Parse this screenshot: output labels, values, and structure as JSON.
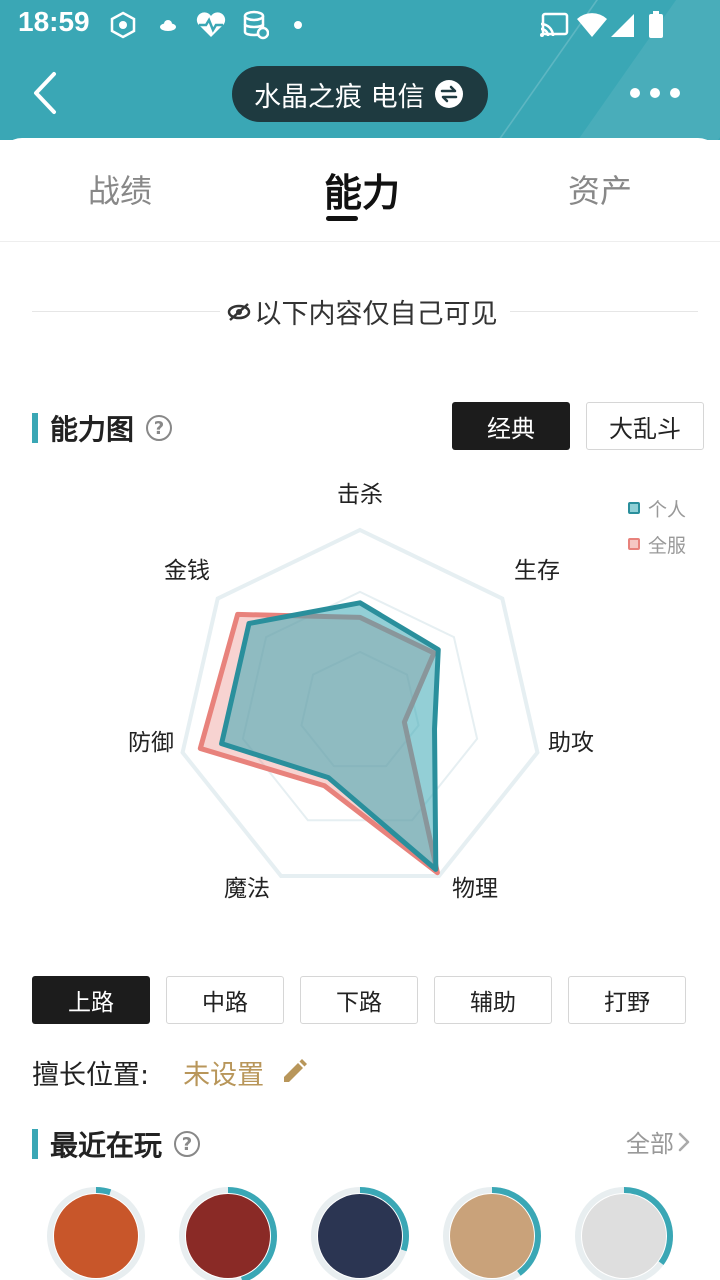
{
  "status_bar": {
    "time": "18:59"
  },
  "header": {
    "server_name": "水晶之痕 电信"
  },
  "tabs": [
    {
      "label": "战绩",
      "active": false
    },
    {
      "label": "能力",
      "active": true
    },
    {
      "label": "资产",
      "active": false
    }
  ],
  "notice": {
    "text": "以下内容仅自己可见"
  },
  "ability": {
    "title": "能力图",
    "modes": [
      {
        "label": "经典",
        "active": true
      },
      {
        "label": "大乱斗",
        "active": false
      }
    ],
    "legend": [
      {
        "label": "个人",
        "color": "#3aa7b5"
      },
      {
        "label": "全服",
        "color": "#e8827c"
      }
    ]
  },
  "chart_data": {
    "type": "radar",
    "axes": [
      "击杀",
      "生存",
      "助攻",
      "物理",
      "魔法",
      "防御",
      "金钱"
    ],
    "range": [
      0,
      100
    ],
    "series": [
      {
        "name": "个人",
        "color": "#3aa7b5",
        "values": [
          60,
          55,
          42,
          96,
          40,
          78,
          78
        ]
      },
      {
        "name": "全服",
        "color": "#e8827c",
        "values": [
          52,
          52,
          25,
          98,
          45,
          90,
          86
        ]
      }
    ]
  },
  "lanes": [
    {
      "label": "上路",
      "active": true
    },
    {
      "label": "中路",
      "active": false
    },
    {
      "label": "下路",
      "active": false
    },
    {
      "label": "辅助",
      "active": false
    },
    {
      "label": "打野",
      "active": false
    }
  ],
  "position": {
    "label": "擅长位置:",
    "value": "未设置"
  },
  "recent": {
    "title": "最近在玩",
    "all_label": "全部",
    "champions": [
      {
        "name": "champion-1",
        "progress": 0.05,
        "bg": "#c8562a"
      },
      {
        "name": "champion-2",
        "progress": 0.45,
        "bg": "#8a2a26"
      },
      {
        "name": "champion-3",
        "progress": 0.3,
        "bg": "#2b3552"
      },
      {
        "name": "champion-4",
        "progress": 0.4,
        "bg": "#c9a27a"
      },
      {
        "name": "champion-5",
        "progress": 0.35,
        "bg": "#dedede"
      }
    ]
  }
}
